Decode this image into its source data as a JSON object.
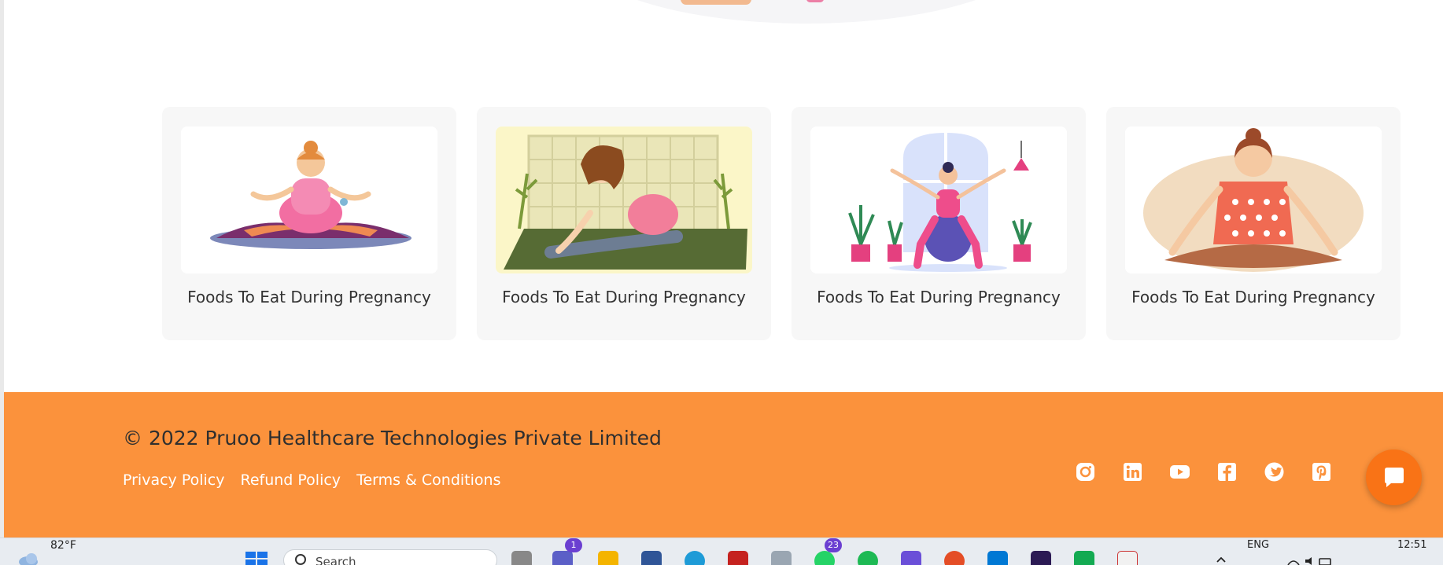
{
  "cards": [
    {
      "title": "Foods To Eat During Pregnancy",
      "image": "meditating-pregnant-woman-illustration"
    },
    {
      "title": "Foods To Eat During Pregnancy",
      "image": "stretching-pregnant-woman-illustration"
    },
    {
      "title": "Foods To Eat During Pregnancy",
      "image": "birthing-ball-exercise-illustration"
    },
    {
      "title": "Foods To Eat During Pregnancy",
      "image": "seated-meditation-illustration"
    }
  ],
  "footer": {
    "copyright": "© 2022 Pruoo Healthcare Technologies Private Limited",
    "links": [
      "Privacy Policy",
      "Refund Policy",
      "Terms & Conditions"
    ],
    "socials": [
      "instagram-icon",
      "linkedin-icon",
      "youtube-icon",
      "facebook-icon",
      "twitter-icon",
      "pinterest-icon"
    ],
    "background": "#fb923c"
  },
  "taskbar": {
    "temperature": "82°F",
    "search_placeholder": "Search",
    "teams_badge": "1",
    "whatsapp_badge": "23",
    "language": "ENG",
    "time": "12:51"
  }
}
